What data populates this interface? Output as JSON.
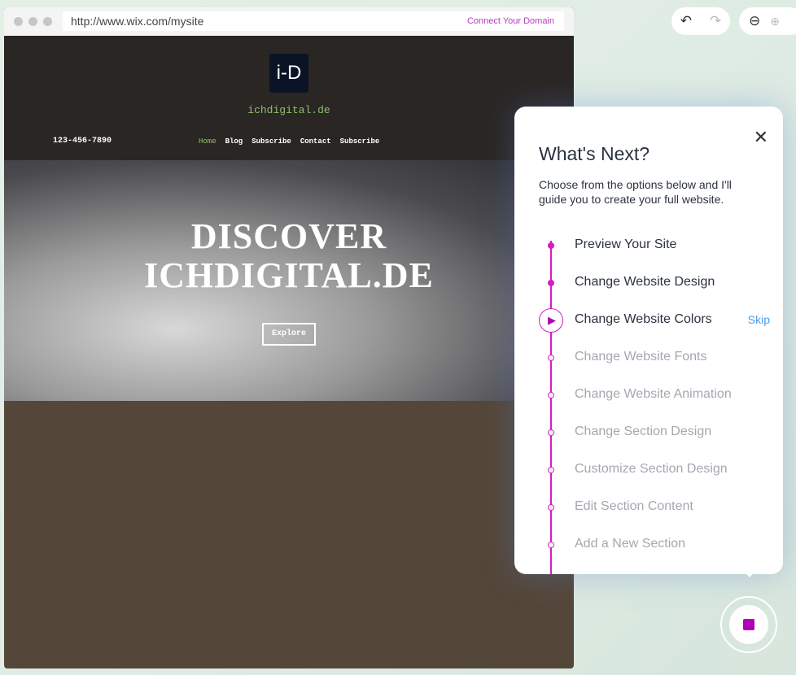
{
  "browser": {
    "url": "http://www.wix.com/mysite",
    "connect_label": "Connect Your Domain"
  },
  "site": {
    "logo": "i-D",
    "name": "ichdigital.de",
    "phone": "123-456-7890",
    "nav": [
      "Home",
      "Blog",
      "Subscribe",
      "Contact",
      "Subscribe"
    ],
    "hero_line1": "DISCOVER",
    "hero_line2": "ICHDIGITAL.DE",
    "explore_label": "Explore"
  },
  "toolbar": {
    "undo_icon": "undo-icon",
    "redo_icon": "redo-icon",
    "zoom_out_icon": "zoom-out-icon",
    "zoom_in_icon": "zoom-in-icon"
  },
  "panel": {
    "title": "What's Next?",
    "description": "Choose from the options below and I'll guide you to create your full website.",
    "skip_label": "Skip",
    "steps": [
      "Preview Your Site",
      "Change Website Design",
      "Change Website Colors",
      "Change Website Fonts",
      "Change Website Animation",
      "Change Section Design",
      "Customize Section Design",
      "Edit Section Content",
      "Add a New Section"
    ],
    "completed_steps": 2,
    "current_step": 3
  },
  "colors": {
    "accent": "#d51cc6",
    "link": "#4a9ee8",
    "stop": "#b000b8"
  }
}
